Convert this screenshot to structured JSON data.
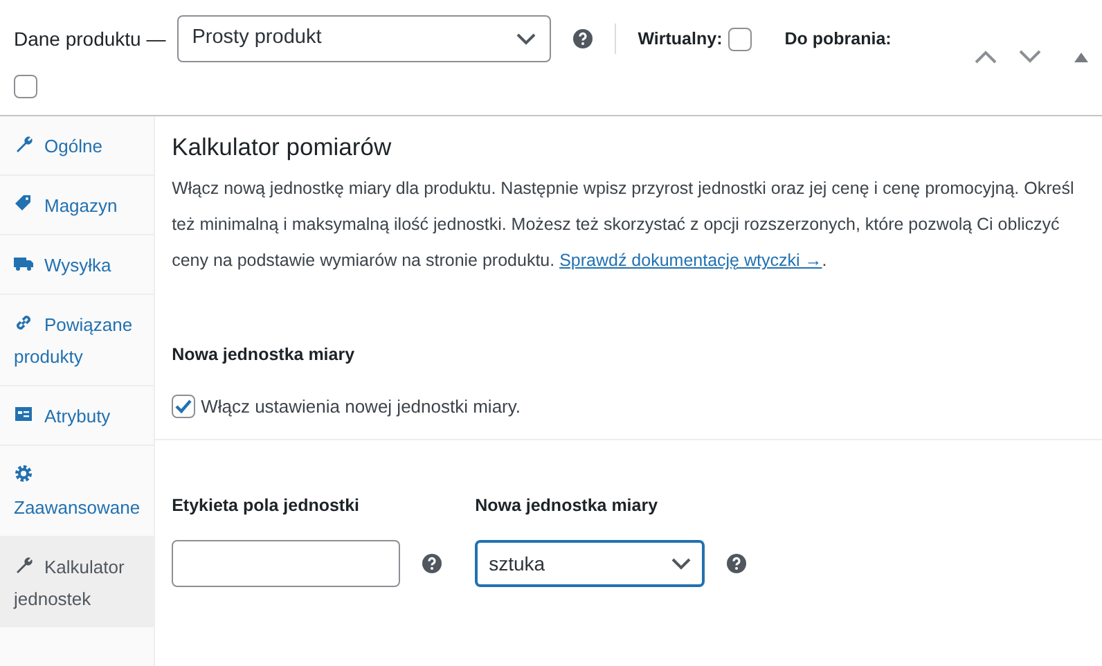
{
  "header": {
    "title": "Dane produktu —",
    "product_type": "Prosty produkt",
    "virtual": {
      "label": "Wirtualny:",
      "checked": false
    },
    "downloadable": {
      "label": "Do pobrania:",
      "checked": false
    }
  },
  "tabs": [
    {
      "label": "Ogólne",
      "selected": false
    },
    {
      "label": "Magazyn",
      "selected": false
    },
    {
      "label": "Wysyłka",
      "selected": false
    },
    {
      "label": "Powiązane produkty",
      "selected": false
    },
    {
      "label": "Atrybuty",
      "selected": false
    },
    {
      "label": "Zaawansowane",
      "selected": false
    },
    {
      "label": "Kalkulator jednostek",
      "selected": true
    }
  ],
  "panel": {
    "title": "Kalkulator pomiarów",
    "description": "Włącz nową jednostkę miary dla produktu. Następnie wpisz przyrost jednostki oraz jej cenę i cenę promocyjną. Określ też minimalną i maksymalną ilość jednostki. Możesz też skorzystać z opcji rozszerzonych, które pozwolą Ci obliczyć ceny na podstawie wymiarów na stronie produktu.",
    "link": "Sprawdź dokumentację wtyczki →",
    "link_suffix": ".",
    "section_title": "Nowa jednostka miary",
    "enable": {
      "label": "Włącz ustawienia nowej jednostki miary.",
      "checked": true
    },
    "fields": [
      {
        "label": "Etykieta pola jednostki",
        "kind": "text"
      },
      {
        "label": "Nowa jednostka miary",
        "kind": "select",
        "value": "sztuka"
      }
    ]
  }
}
